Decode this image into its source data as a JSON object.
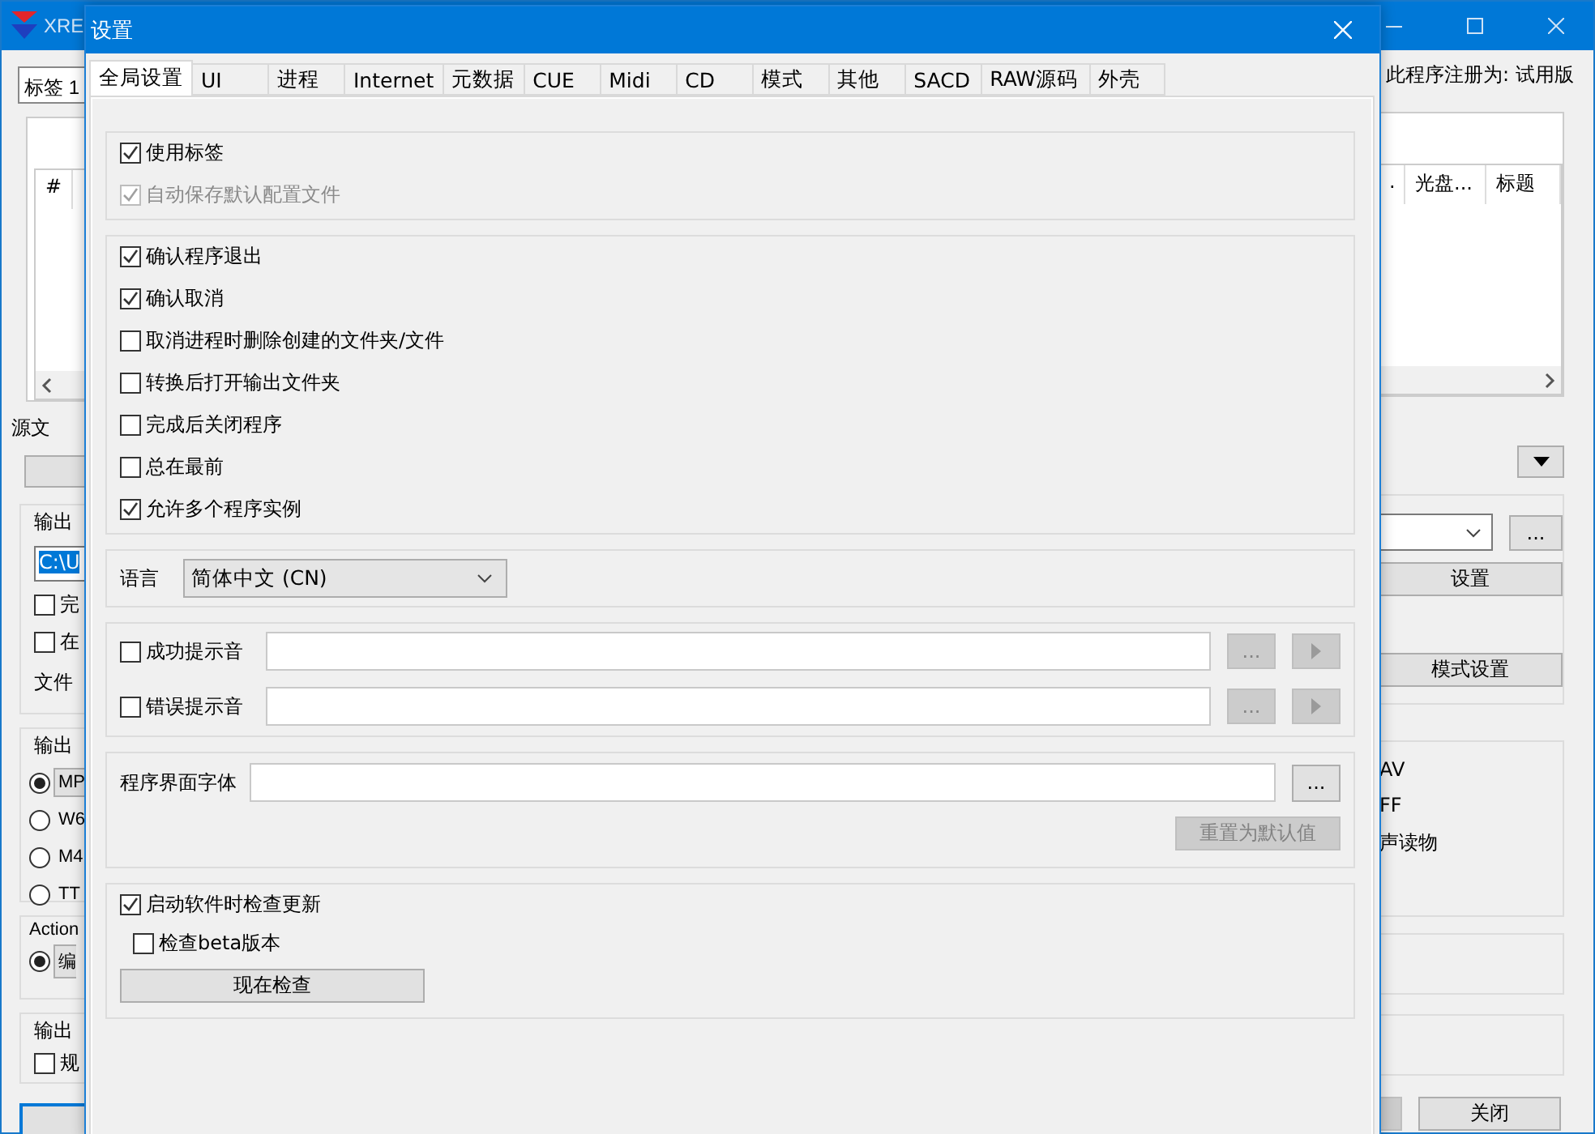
{
  "main_window": {
    "title": "XRE",
    "tab": "标签 1",
    "registration": "此程序注册为: 试用版",
    "list_columns_left": [
      "#"
    ],
    "list_columns_right": [
      ".",
      "光盘...",
      "标题"
    ],
    "source_label": "源文",
    "output_path_label": "输出",
    "output_path": "C:\\U",
    "left_checks": [
      {
        "label": "完",
        "checked": false
      },
      {
        "label": "在",
        "checked": false
      }
    ],
    "filename_label": "文件",
    "format_label": "输出",
    "formats": [
      {
        "label": "MP",
        "selected": true
      },
      {
        "label": "W6",
        "selected": false
      },
      {
        "label": "M4",
        "selected": false
      },
      {
        "label": "TT",
        "selected": false
      }
    ],
    "browse_button": "...",
    "right_format_texts": [
      "AV",
      "FF",
      "声读物"
    ],
    "action_label": "Action",
    "actions": [
      {
        "label": "编",
        "selected": true
      }
    ],
    "output_settings_label": "输出",
    "output_settings_checks": [
      {
        "label": "规",
        "checked": false
      }
    ],
    "settings_button": "设置",
    "mode_button": "模式设置",
    "close_button": "关闭"
  },
  "dialog": {
    "title": "设置",
    "tabs": [
      {
        "label": "全局设置",
        "selected": true
      },
      {
        "label": "UI",
        "selected": false
      },
      {
        "label": "进程",
        "selected": false
      },
      {
        "label": "Internet",
        "selected": false
      },
      {
        "label": "元数据",
        "selected": false
      },
      {
        "label": "CUE",
        "selected": false
      },
      {
        "label": "Midi",
        "selected": false
      },
      {
        "label": "CD",
        "selected": false
      },
      {
        "label": "模式",
        "selected": false
      },
      {
        "label": "其他",
        "selected": false
      },
      {
        "label": "SACD",
        "selected": false
      },
      {
        "label": "RAW源码",
        "selected": false
      },
      {
        "label": "外壳",
        "selected": false
      }
    ],
    "tag_options": [
      {
        "label": "使用标签",
        "checked": true,
        "disabled": false
      },
      {
        "label": "自动保存默认配置文件",
        "checked": true,
        "disabled": true
      }
    ],
    "behavior_options": [
      {
        "label": "确认程序退出",
        "checked": true
      },
      {
        "label": "确认取消",
        "checked": true
      },
      {
        "label": "取消进程时删除创建的文件夹/文件",
        "checked": false
      },
      {
        "label": "转换后打开输出文件夹",
        "checked": false
      },
      {
        "label": "完成后关闭程序",
        "checked": false
      },
      {
        "label": "总在最前",
        "checked": false
      },
      {
        "label": "允许多个程序实例",
        "checked": true
      }
    ],
    "language": {
      "label": "语言",
      "value": "简体中文 (CN)"
    },
    "sounds": [
      {
        "label": "成功提示音",
        "checked": false,
        "browse": "...",
        "disabled": true
      },
      {
        "label": "错误提示音",
        "checked": false,
        "browse": "...",
        "disabled": true
      }
    ],
    "font": {
      "label": "程序界面字体",
      "browse": "...",
      "reset": "重置为默认值",
      "reset_disabled": true
    },
    "updates": {
      "check_on_start": {
        "label": "启动软件时检查更新",
        "checked": true
      },
      "beta": {
        "label": "检查beta版本",
        "checked": false
      },
      "check_now": "现在检查"
    }
  }
}
